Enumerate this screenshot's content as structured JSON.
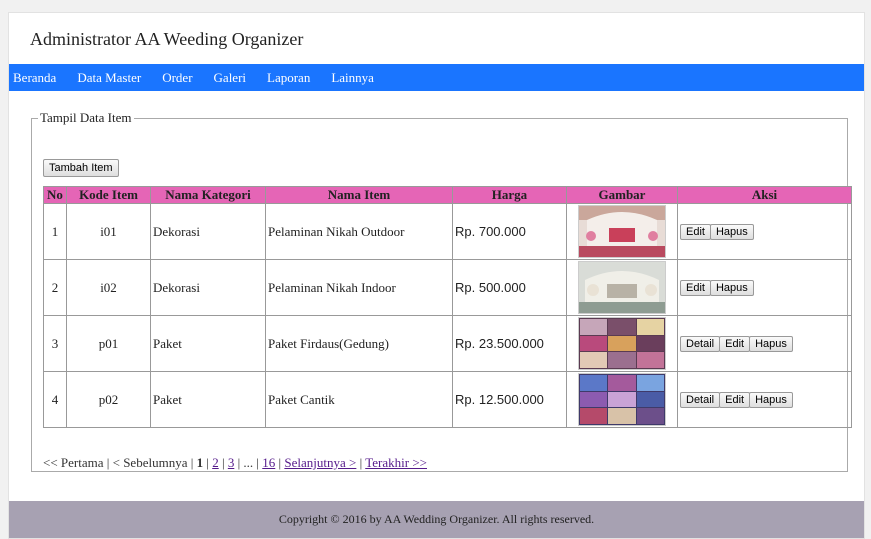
{
  "header": {
    "title": "Administrator AA Weeding Organizer"
  },
  "nav": {
    "items": [
      "Beranda",
      "Data Master",
      "Order",
      "Galeri",
      "Laporan",
      "Lainnya"
    ]
  },
  "panel": {
    "legend": "Tampil Data Item",
    "add_button": "Tambah Item"
  },
  "table": {
    "headers": [
      "No",
      "Kode Item",
      "Nama Kategori",
      "Nama Item",
      "Harga",
      "Gambar",
      "Aksi"
    ],
    "rows": [
      {
        "no": "1",
        "kode": "i01",
        "kategori": "Dekorasi",
        "nama": "Pelaminan Nikah Outdoor",
        "harga": "Rp. 700.000",
        "gambar": "decoration-photo",
        "aksi": [
          "Edit",
          "Hapus"
        ]
      },
      {
        "no": "2",
        "kode": "i02",
        "kategori": "Dekorasi",
        "nama": "Pelaminan Nikah Indoor",
        "harga": "Rp. 500.000",
        "gambar": "decoration-photo",
        "aksi": [
          "Edit",
          "Hapus"
        ]
      },
      {
        "no": "3",
        "kode": "p01",
        "kategori": "Paket",
        "nama": "Paket Firdaus(Gedung)",
        "harga": "Rp. 23.500.000",
        "gambar": "package-collage",
        "aksi": [
          "Detail",
          "Edit",
          "Hapus"
        ]
      },
      {
        "no": "4",
        "kode": "p02",
        "kategori": "Paket",
        "nama": "Paket Cantik",
        "harga": "Rp. 12.500.000",
        "gambar": "package-collage",
        "aksi": [
          "Detail",
          "Edit",
          "Hapus"
        ]
      }
    ]
  },
  "pager": {
    "first": "<< Pertama",
    "prev": "< Sebelumnya",
    "sep": "|",
    "current": "1",
    "p2": "2",
    "p3": "3",
    "ellipsis": "...",
    "last_num": "16",
    "next": "Selanjutnya >",
    "last": "Terakhir >>"
  },
  "footer": {
    "text": "Copyright © 2016 by AA Wedding Organizer. All rights reserved."
  },
  "colors": {
    "nav_bg": "#1a75ff",
    "table_header": "#e565b6",
    "footer_bg": "#a7a1b2"
  }
}
